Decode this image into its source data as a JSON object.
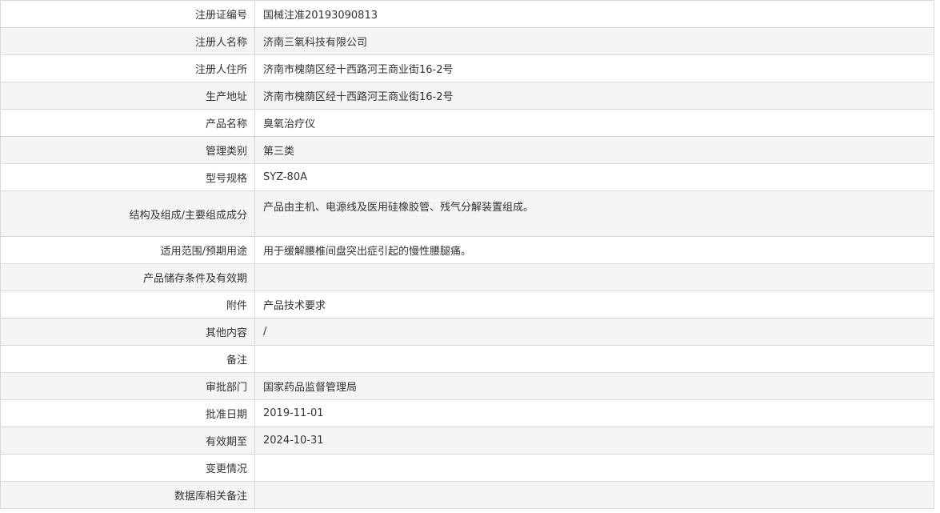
{
  "rows": [
    {
      "label": "注册证编号",
      "value": "国械注准20193090813"
    },
    {
      "label": "注册人名称",
      "value": "济南三氧科技有限公司"
    },
    {
      "label": "注册人住所",
      "value": "济南市槐荫区经十西路河王商业街16-2号"
    },
    {
      "label": "生产地址",
      "value": "济南市槐荫区经十西路河王商业街16-2号"
    },
    {
      "label": "产品名称",
      "value": "臭氧治疗仪"
    },
    {
      "label": "管理类别",
      "value": "第三类"
    },
    {
      "label": "型号规格",
      "value": "SYZ-80A"
    },
    {
      "label": "结构及组成/主要组成成分",
      "value": "产品由主机、电源线及医用硅橡胶管、残气分解装置组成。"
    },
    {
      "label": "适用范围/预期用途",
      "value": "用于缓解腰椎间盘突出症引起的慢性腰腿痛。"
    },
    {
      "label": "产品储存条件及有效期",
      "value": ""
    },
    {
      "label": "附件",
      "value": "产品技术要求"
    },
    {
      "label": "其他内容",
      "value": "/"
    },
    {
      "label": "备注",
      "value": ""
    },
    {
      "label": "审批部门",
      "value": "国家药品监督管理局"
    },
    {
      "label": "批准日期",
      "value": "2019-11-01"
    },
    {
      "label": "有效期至",
      "value": "2024-10-31"
    },
    {
      "label": "变更情况",
      "value": ""
    },
    {
      "label": "数据库相关备注",
      "value": ""
    }
  ]
}
